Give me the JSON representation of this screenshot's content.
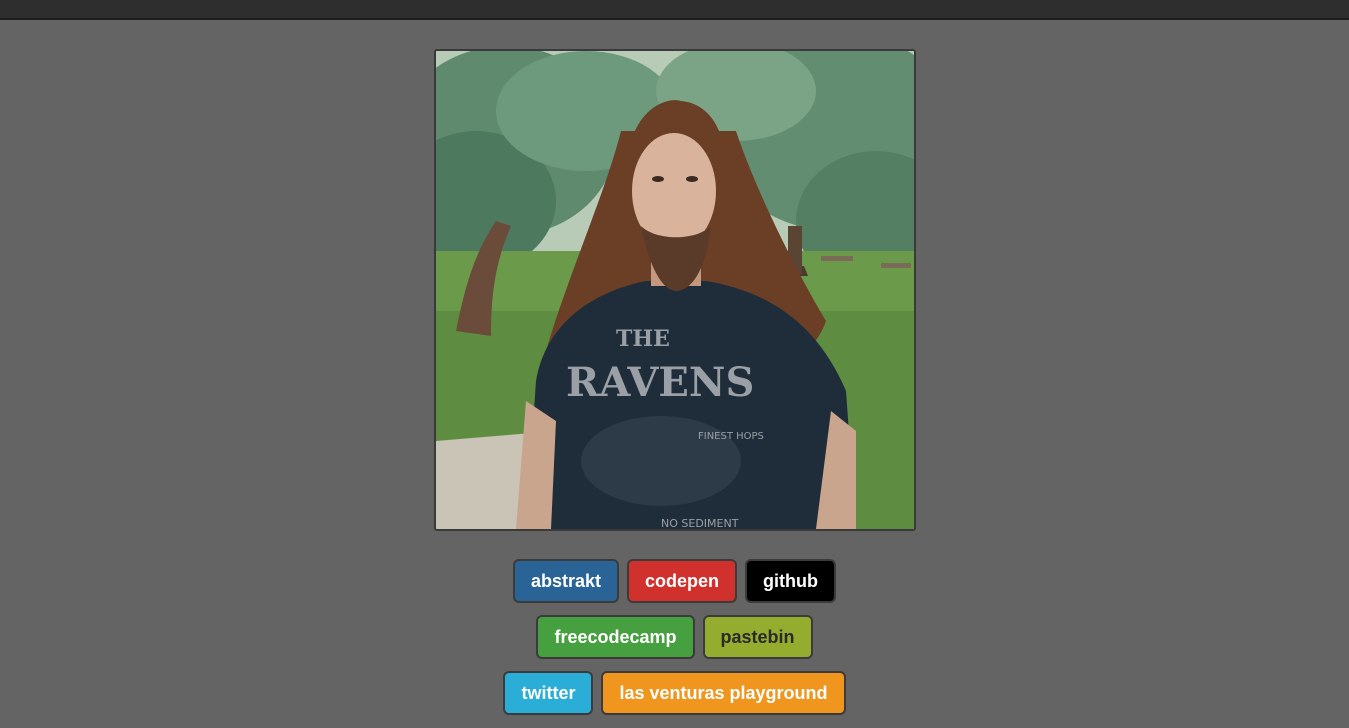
{
  "profile": {
    "photo": {
      "subject": "portrait of a long-haired man in a dark t-shirt standing in a park",
      "shirt_text": [
        "THE",
        "RAVENS",
        "FINEST HOPS",
        "NO SEDIMENT"
      ]
    }
  },
  "links": [
    {
      "label": "abstrakt",
      "color": "#2a6496",
      "text_color": "#ffffff"
    },
    {
      "label": "codepen",
      "color": "#d0312d",
      "text_color": "#ffffff"
    },
    {
      "label": "github",
      "color": "#000000",
      "text_color": "#ffffff"
    },
    {
      "label": "freecodecamp",
      "color": "#47a03f",
      "text_color": "#ffffff"
    },
    {
      "label": "pastebin",
      "color": "#95ad2e",
      "text_color": "#2a2a2a"
    },
    {
      "label": "twitter",
      "color": "#2aaed8",
      "text_color": "#ffffff"
    },
    {
      "label": "las venturas playground",
      "color": "#f0961e",
      "text_color": "#ffffff"
    }
  ],
  "colors": {
    "page_background": "#646464",
    "top_bar": "#2e2e2e",
    "button_border": "#3b3b3b"
  }
}
